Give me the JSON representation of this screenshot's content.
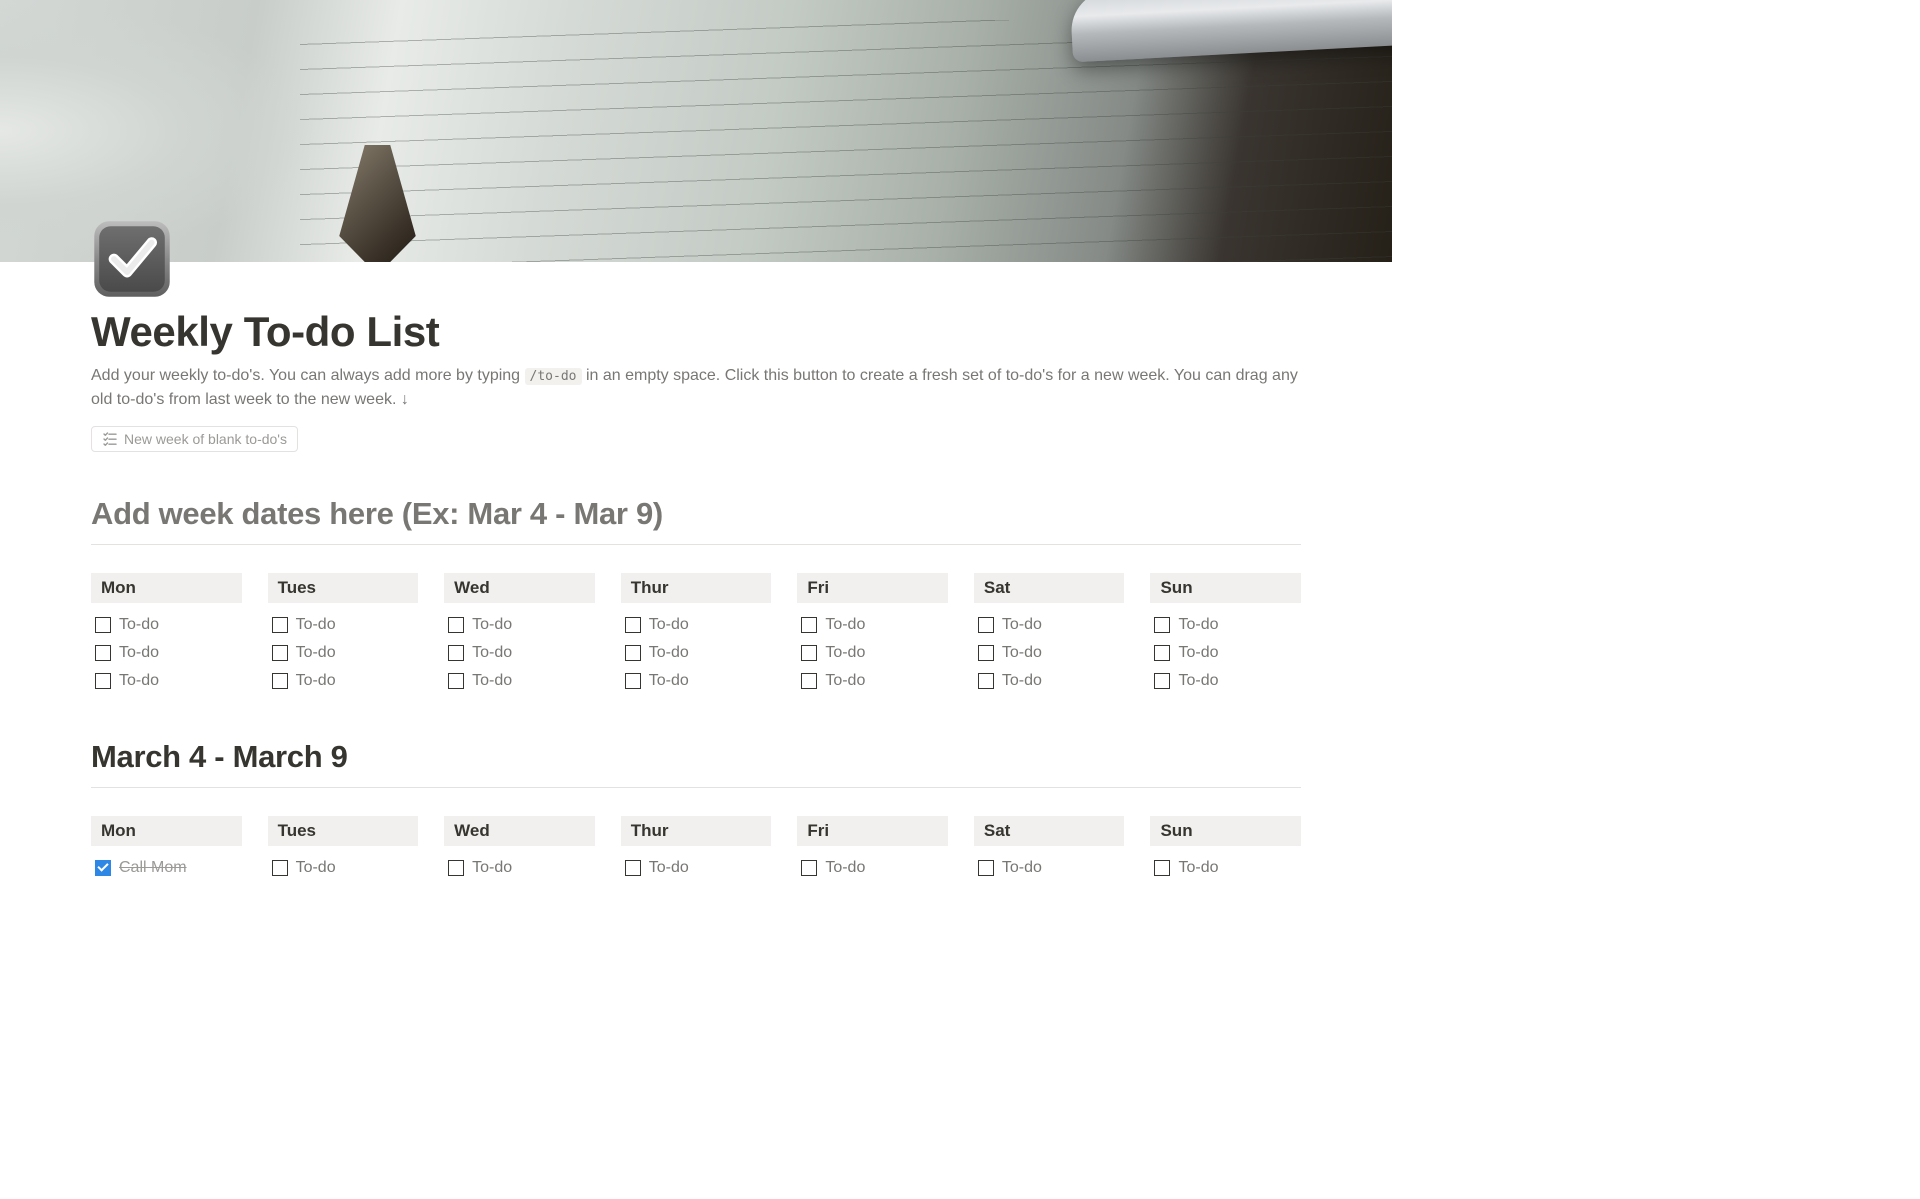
{
  "page": {
    "title": "Weekly To-do List",
    "description_pre": "Add your weekly to-do's. You can always add more by typing ",
    "description_code": "/to-do",
    "description_post": " in an empty space. Click this button to create a fresh set of to-do's for a new week. You can drag any old to-do's from last week to the new week. ↓",
    "new_week_button": "New week of blank to-do's"
  },
  "sections": [
    {
      "heading": "Add week dates here (Ex: Mar 4 - Mar 9)",
      "heading_dark": false,
      "days": [
        {
          "label": "Mon",
          "todos": [
            {
              "text": "To-do",
              "checked": false
            },
            {
              "text": "To-do",
              "checked": false
            },
            {
              "text": "To-do",
              "checked": false
            }
          ]
        },
        {
          "label": "Tues",
          "todos": [
            {
              "text": "To-do",
              "checked": false
            },
            {
              "text": "To-do",
              "checked": false
            },
            {
              "text": "To-do",
              "checked": false
            }
          ]
        },
        {
          "label": "Wed",
          "todos": [
            {
              "text": "To-do",
              "checked": false
            },
            {
              "text": "To-do",
              "checked": false
            },
            {
              "text": "To-do",
              "checked": false
            }
          ]
        },
        {
          "label": "Thur",
          "todos": [
            {
              "text": "To-do",
              "checked": false
            },
            {
              "text": "To-do",
              "checked": false
            },
            {
              "text": "To-do",
              "checked": false
            }
          ]
        },
        {
          "label": "Fri",
          "todos": [
            {
              "text": "To-do",
              "checked": false
            },
            {
              "text": "To-do",
              "checked": false
            },
            {
              "text": "To-do",
              "checked": false
            }
          ]
        },
        {
          "label": "Sat",
          "todos": [
            {
              "text": "To-do",
              "checked": false
            },
            {
              "text": "To-do",
              "checked": false
            },
            {
              "text": "To-do",
              "checked": false
            }
          ]
        },
        {
          "label": "Sun",
          "todos": [
            {
              "text": "To-do",
              "checked": false
            },
            {
              "text": "To-do",
              "checked": false
            },
            {
              "text": "To-do",
              "checked": false
            }
          ]
        }
      ]
    },
    {
      "heading": "March 4 - March 9",
      "heading_dark": true,
      "days": [
        {
          "label": "Mon",
          "todos": [
            {
              "text": "Call Mom",
              "checked": true
            }
          ]
        },
        {
          "label": "Tues",
          "todos": [
            {
              "text": "To-do",
              "checked": false
            }
          ]
        },
        {
          "label": "Wed",
          "todos": [
            {
              "text": "To-do",
              "checked": false
            }
          ]
        },
        {
          "label": "Thur",
          "todos": [
            {
              "text": "To-do",
              "checked": false
            }
          ]
        },
        {
          "label": "Fri",
          "todos": [
            {
              "text": "To-do",
              "checked": false
            }
          ]
        },
        {
          "label": "Sat",
          "todos": [
            {
              "text": "To-do",
              "checked": false
            }
          ]
        },
        {
          "label": "Sun",
          "todos": [
            {
              "text": "To-do",
              "checked": false
            }
          ]
        }
      ]
    }
  ]
}
